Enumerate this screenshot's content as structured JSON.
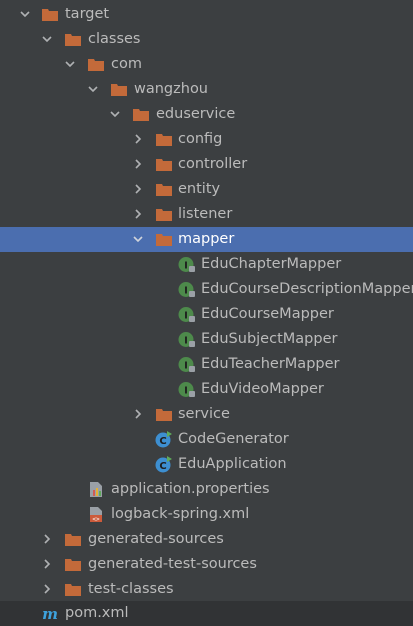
{
  "tree": {
    "rows": [
      {
        "label": "target",
        "icon": "folder-icon",
        "expanded": true
      },
      {
        "label": "classes",
        "icon": "folder-icon",
        "expanded": true
      },
      {
        "label": "com",
        "icon": "folder-icon",
        "expanded": true
      },
      {
        "label": "wangzhou",
        "icon": "folder-icon",
        "expanded": true
      },
      {
        "label": "eduservice",
        "icon": "folder-icon",
        "expanded": true
      },
      {
        "label": "config",
        "icon": "folder-icon",
        "expanded": false
      },
      {
        "label": "controller",
        "icon": "folder-icon",
        "expanded": false
      },
      {
        "label": "entity",
        "icon": "folder-icon",
        "expanded": false
      },
      {
        "label": "listener",
        "icon": "folder-icon",
        "expanded": false
      },
      {
        "label": "mapper",
        "icon": "folder-icon",
        "expanded": true,
        "selected": true
      },
      {
        "label": "EduChapterMapper",
        "icon": "interface-icon"
      },
      {
        "label": "EduCourseDescriptionMapper",
        "icon": "interface-icon"
      },
      {
        "label": "EduCourseMapper",
        "icon": "interface-icon"
      },
      {
        "label": "EduSubjectMapper",
        "icon": "interface-icon"
      },
      {
        "label": "EduTeacherMapper",
        "icon": "interface-icon"
      },
      {
        "label": "EduVideoMapper",
        "icon": "interface-icon"
      },
      {
        "label": "service",
        "icon": "folder-icon",
        "expanded": false
      },
      {
        "label": "CodeGenerator",
        "icon": "class-icon"
      },
      {
        "label": "EduApplication",
        "icon": "class-icon"
      },
      {
        "label": "application.properties",
        "icon": "properties-file-icon"
      },
      {
        "label": "logback-spring.xml",
        "icon": "xml-file-icon"
      },
      {
        "label": "generated-sources",
        "icon": "folder-icon",
        "expanded": false
      },
      {
        "label": "generated-test-sources",
        "icon": "folder-icon",
        "expanded": false
      },
      {
        "label": "test-classes",
        "icon": "folder-icon",
        "expanded": false
      },
      {
        "label": "pom.xml",
        "icon": "maven-file-icon"
      }
    ]
  },
  "colors": {
    "background": "#3c3f41",
    "selection": "#4b6eaf",
    "text": "#bbbbbb",
    "folder": "#c36a3a",
    "interface_badge": "#4d8a4b",
    "class_badge": "#3d8fd1",
    "maven": "#3ea2dd"
  }
}
